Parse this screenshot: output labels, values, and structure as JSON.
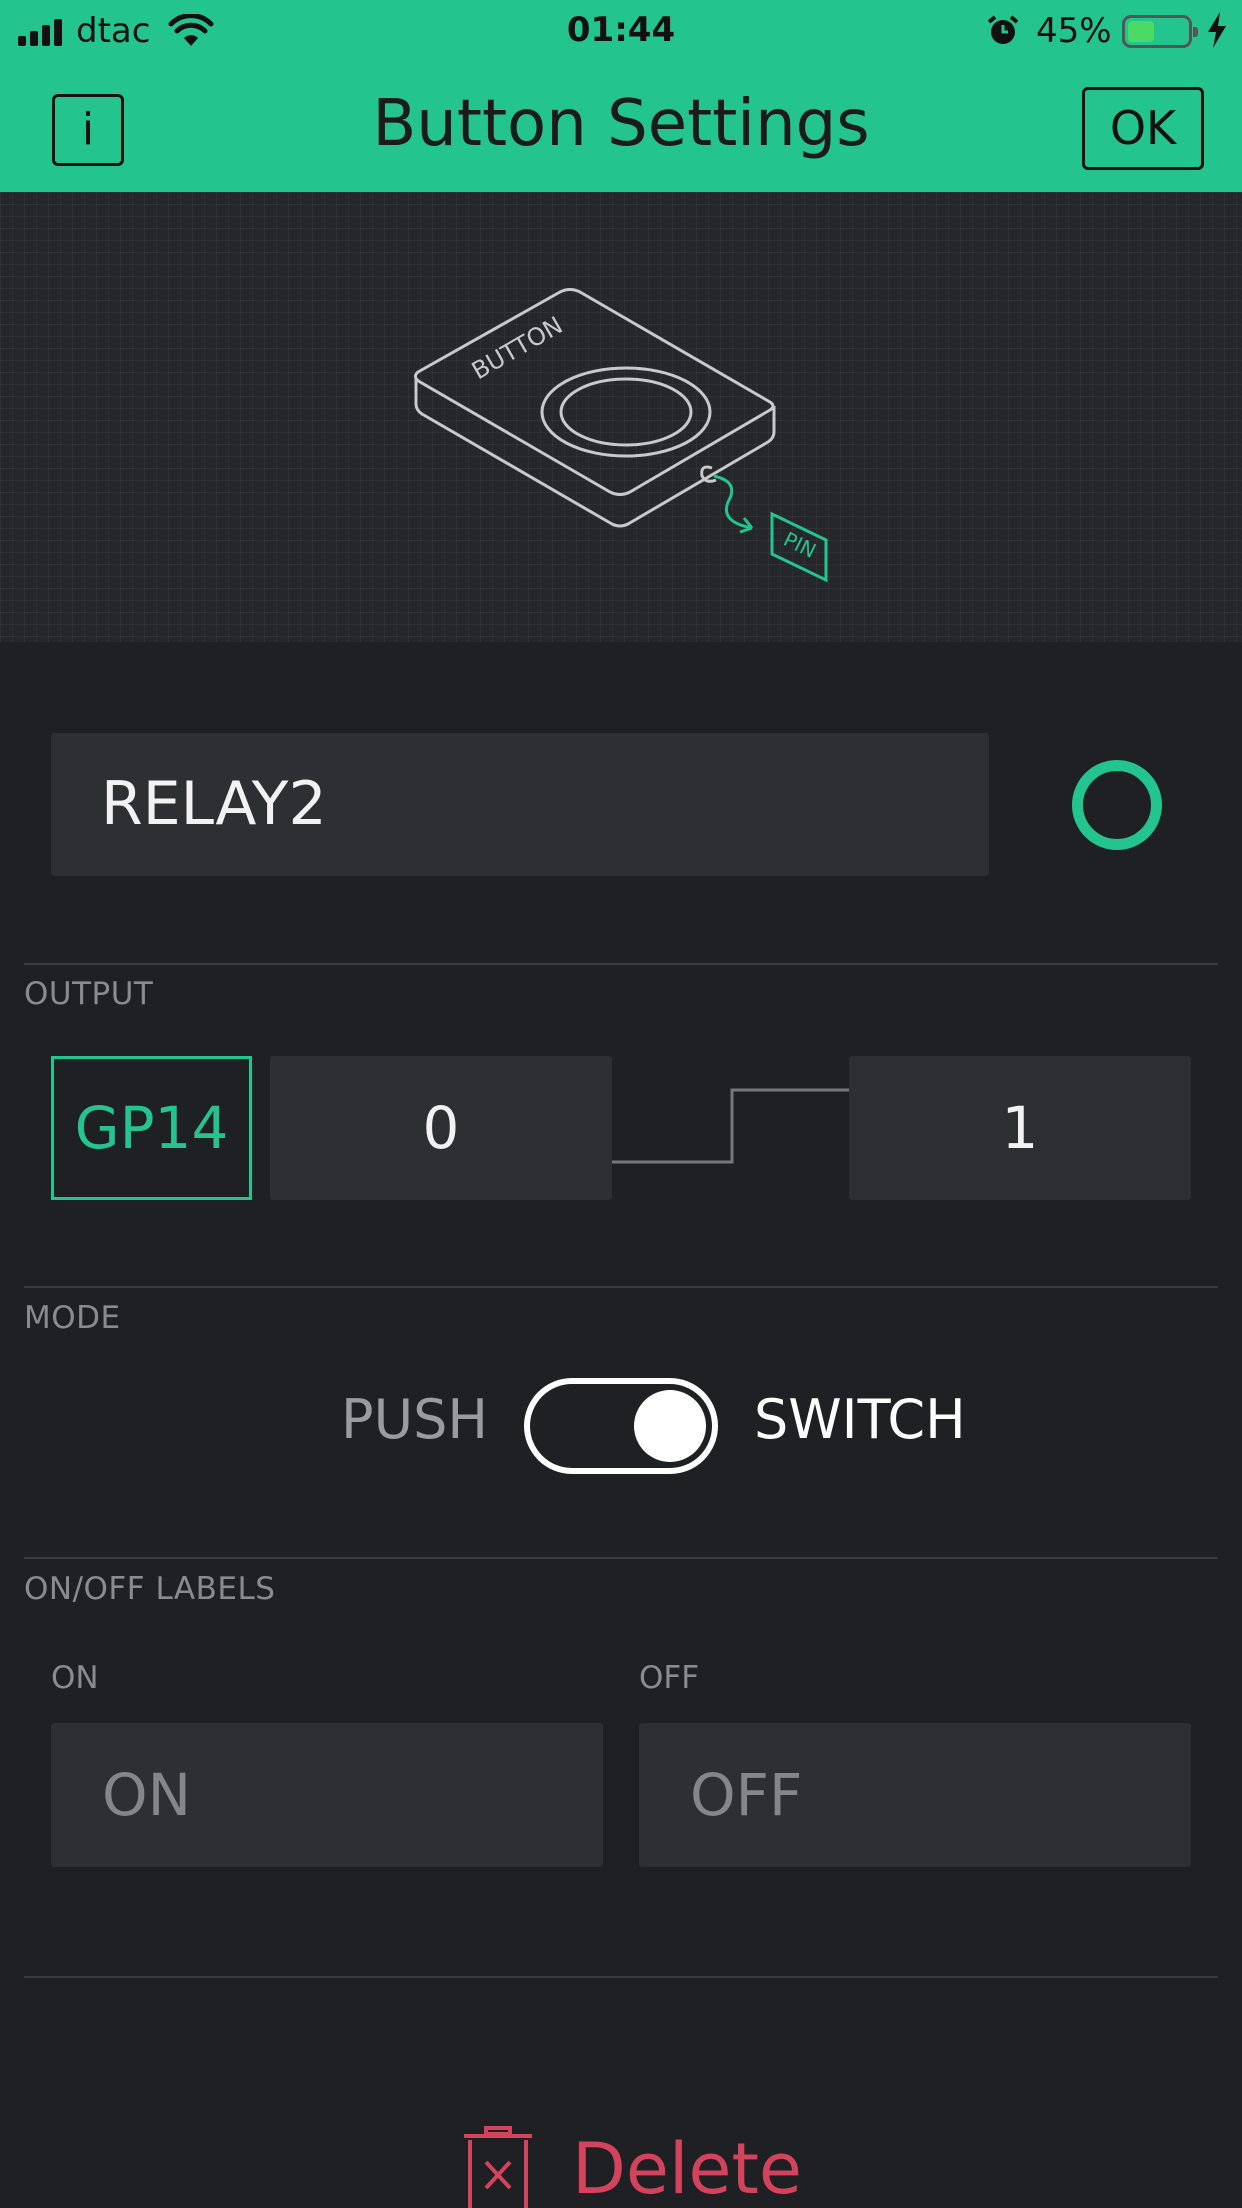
{
  "status_bar": {
    "carrier": "dtac",
    "time": "01:44",
    "battery_percent": "45%",
    "battery_level": 0.45,
    "icons": [
      "signal-icon",
      "wifi-icon",
      "alarm-icon",
      "battery-icon",
      "charging-bolt-icon"
    ]
  },
  "header": {
    "info_label": "i",
    "title": "Button Settings",
    "ok_label": "OK"
  },
  "illustration": {
    "button_text": "BUTTON",
    "pin_text": "PIN"
  },
  "name_field": {
    "value": "RELAY2"
  },
  "color": {
    "accent": "#23c48e",
    "danger": "#d3435c"
  },
  "output": {
    "section_label": "OUTPUT",
    "pin": "GP14",
    "low_value": "0",
    "high_value": "1"
  },
  "mode": {
    "section_label": "MODE",
    "push_label": "PUSH",
    "switch_label": "SWITCH",
    "selected": "SWITCH"
  },
  "labels": {
    "section_label": "ON/OFF LABELS",
    "on_caption": "ON",
    "off_caption": "OFF",
    "on_value": "ON",
    "off_value": "OFF"
  },
  "delete": {
    "label": "Delete"
  }
}
